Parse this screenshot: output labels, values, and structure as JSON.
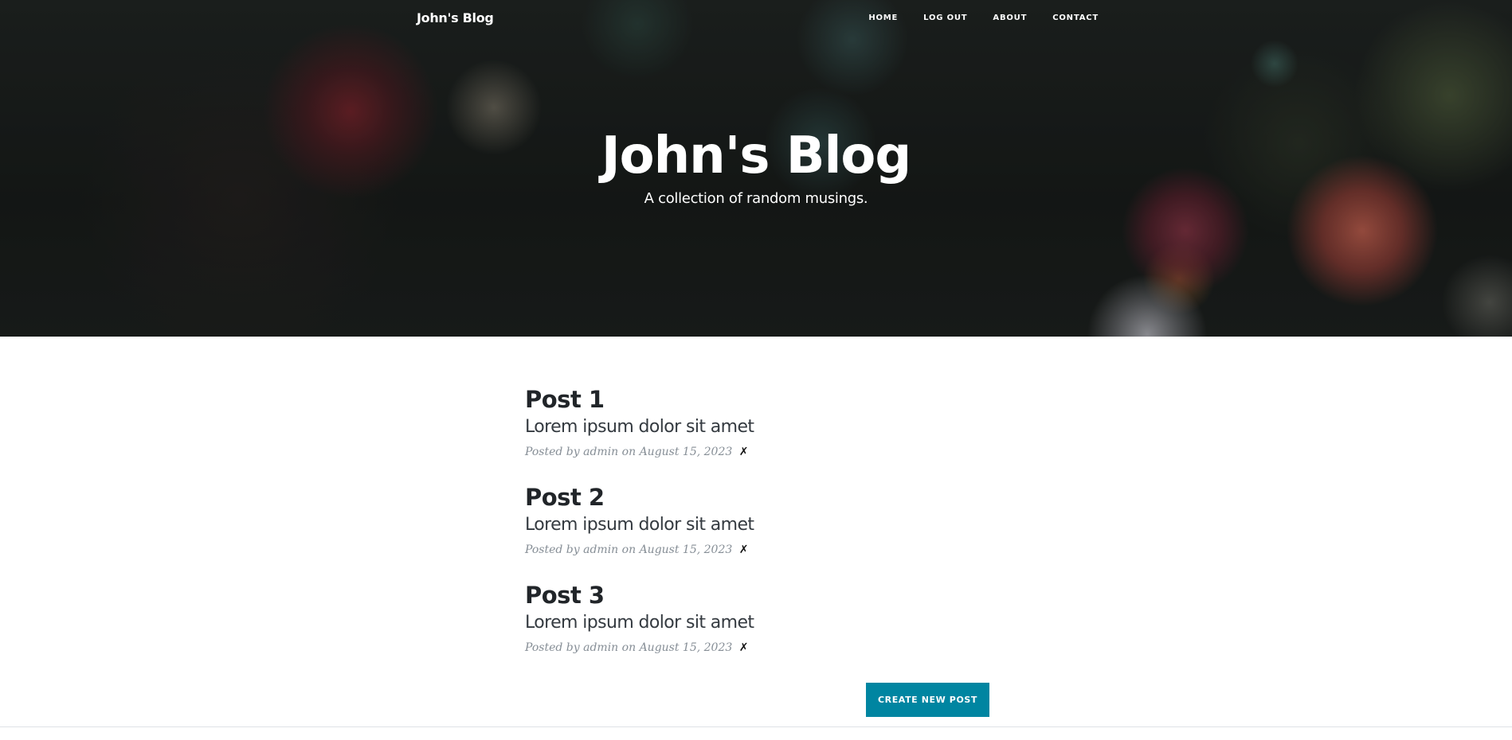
{
  "navbar": {
    "brand": "John's Blog",
    "links": [
      "HOME",
      "LOG OUT",
      "ABOUT",
      "CONTACT"
    ]
  },
  "header": {
    "title": "John's Blog",
    "subtitle": "A collection of random musings."
  },
  "posts": [
    {
      "title": "Post 1",
      "subtitle": "Lorem ipsum dolor sit amet",
      "meta_prefix": "Posted by",
      "author": "admin",
      "meta_on": "on",
      "date": "August 15, 2023",
      "delete_label": "✗"
    },
    {
      "title": "Post 2",
      "subtitle": "Lorem ipsum dolor sit amet",
      "meta_prefix": "Posted by",
      "author": "admin",
      "meta_on": "on",
      "date": "August 15, 2023",
      "delete_label": "✗"
    },
    {
      "title": "Post 3",
      "subtitle": "Lorem ipsum dolor sit amet",
      "meta_prefix": "Posted by",
      "author": "admin",
      "meta_on": "on",
      "date": "August 15, 2023",
      "delete_label": "✗"
    }
  ],
  "actions": {
    "create_label": "CREATE NEW POST"
  },
  "colors": {
    "accent": "#0085a1",
    "heading": "#212529",
    "meta": "#868e96"
  }
}
